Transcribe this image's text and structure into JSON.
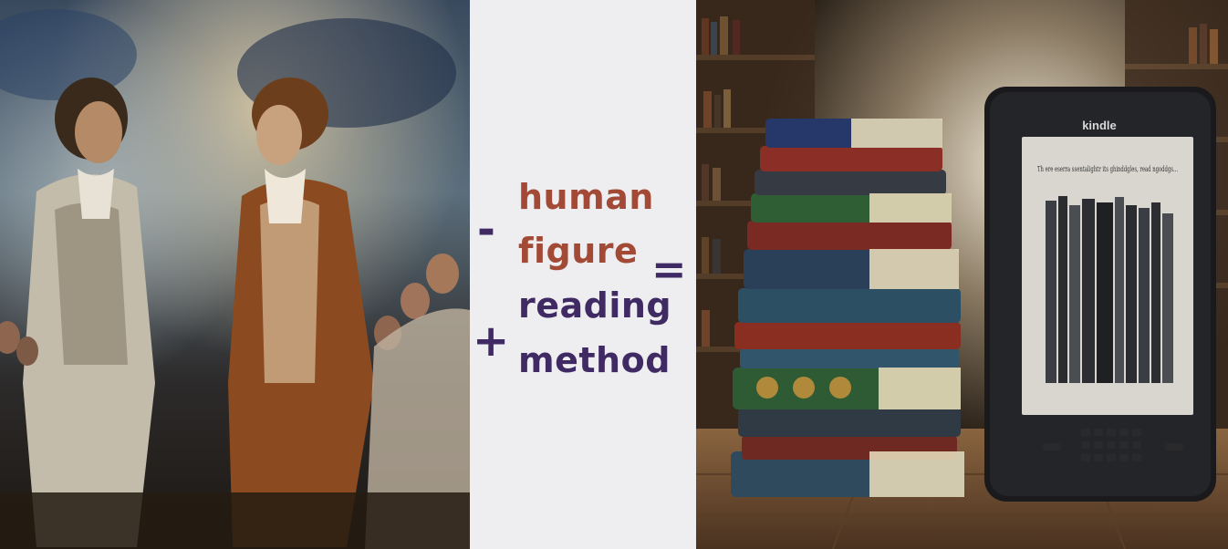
{
  "equation": {
    "minus_sign": "-",
    "removed_terms": [
      "human",
      "figure"
    ],
    "plus_sign": "+",
    "added_terms": [
      "reading",
      "method"
    ],
    "equals_sign": "="
  },
  "kindle": {
    "brand": "kindle",
    "screen_text": "Th ere eserra ssentalightr its ghinddgles, read ngoddgs..."
  },
  "colors": {
    "removed_terms": "#a24a35",
    "added_terms": "#3f2a63",
    "operators": "#3f2a63",
    "background": "#eeedf0"
  }
}
